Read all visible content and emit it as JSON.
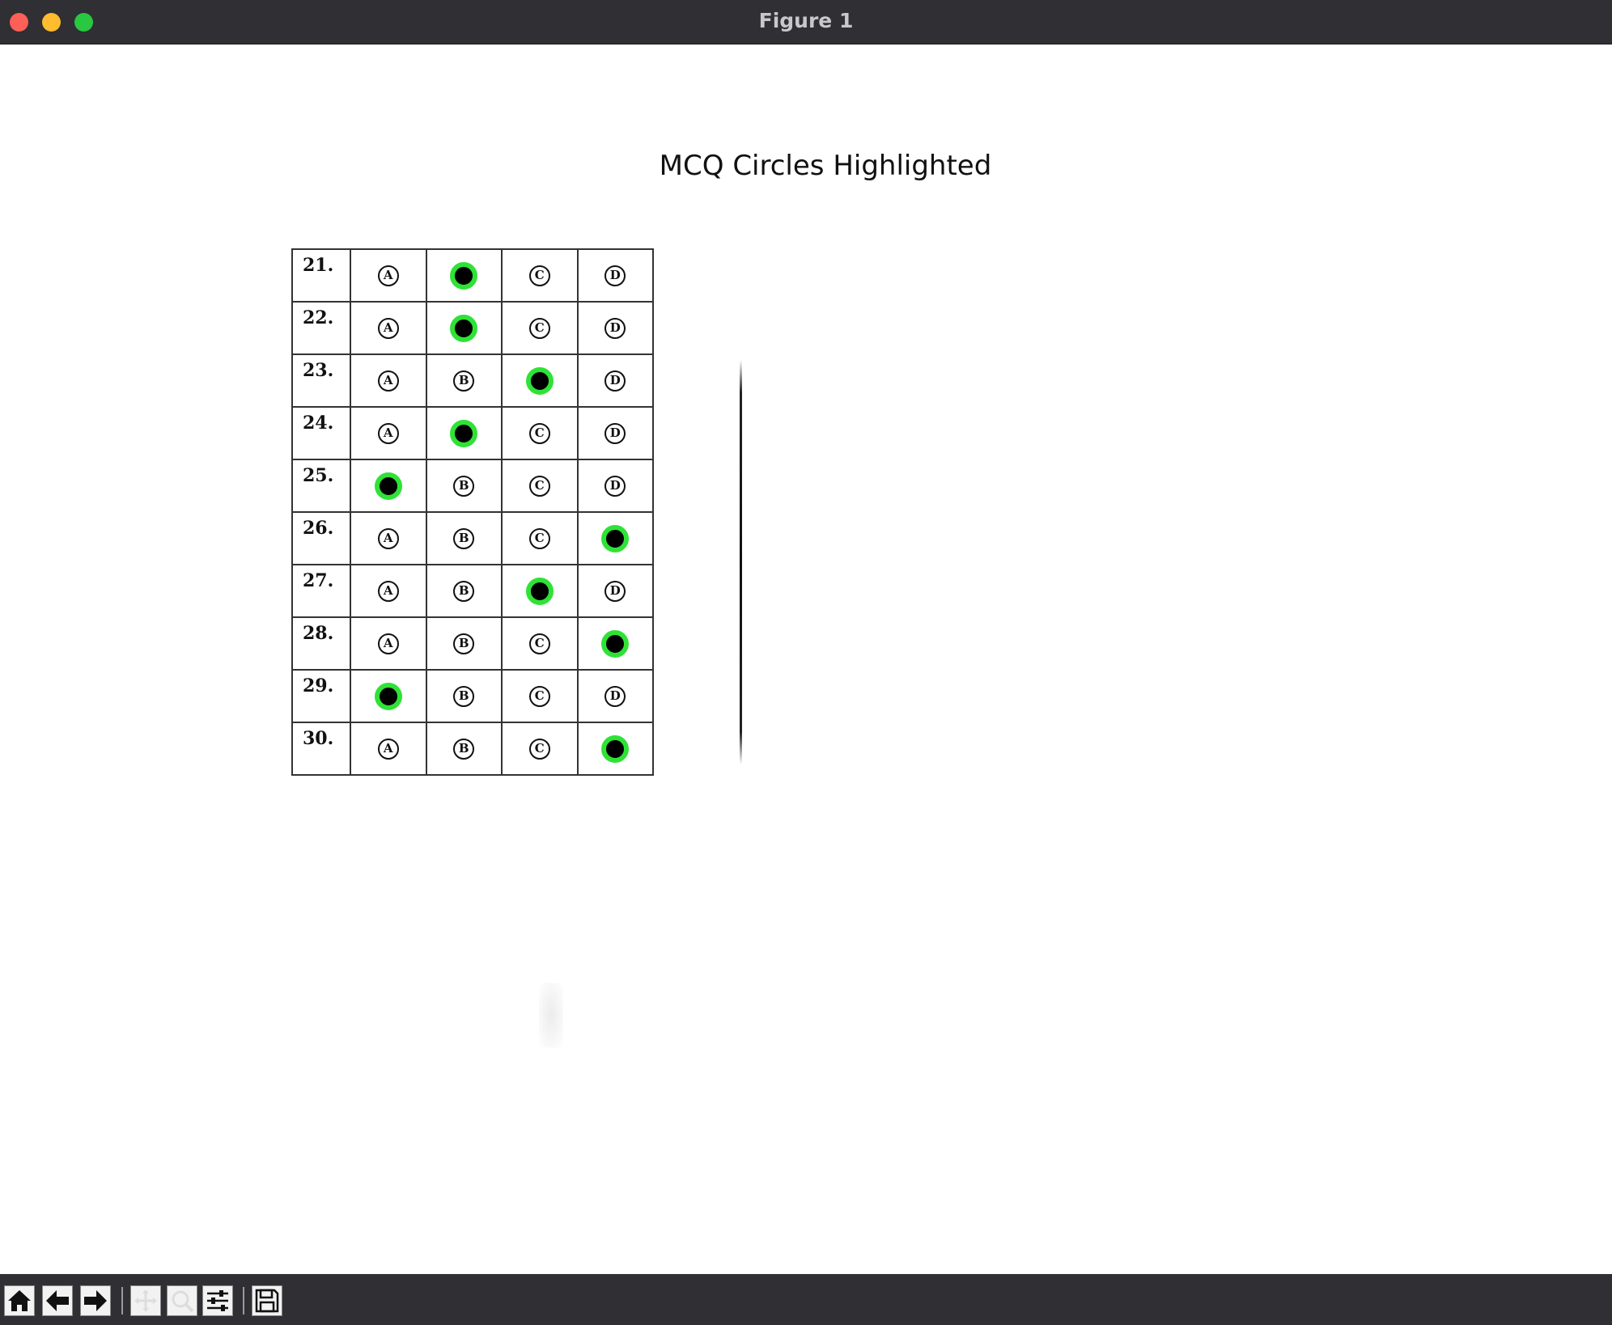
{
  "window": {
    "title": "Figure 1"
  },
  "plot": {
    "title": "MCQ Circles Highlighted"
  },
  "answer_sheet": {
    "rows": [
      {
        "number": "21.",
        "options": [
          "A",
          "B",
          "C",
          "D"
        ],
        "marked": 1
      },
      {
        "number": "22.",
        "options": [
          "A",
          "B",
          "C",
          "D"
        ],
        "marked": 1
      },
      {
        "number": "23.",
        "options": [
          "A",
          "B",
          "C",
          "D"
        ],
        "marked": 2
      },
      {
        "number": "24.",
        "options": [
          "A",
          "B",
          "C",
          "D"
        ],
        "marked": 1
      },
      {
        "number": "25.",
        "options": [
          "A",
          "B",
          "C",
          "D"
        ],
        "marked": 0
      },
      {
        "number": "26.",
        "options": [
          "A",
          "B",
          "C",
          "D"
        ],
        "marked": 3
      },
      {
        "number": "27.",
        "options": [
          "A",
          "B",
          "C",
          "D"
        ],
        "marked": 2
      },
      {
        "number": "28.",
        "options": [
          "A",
          "B",
          "C",
          "D"
        ],
        "marked": 3
      },
      {
        "number": "29.",
        "options": [
          "A",
          "B",
          "C",
          "D"
        ],
        "marked": 0
      },
      {
        "number": "30.",
        "options": [
          "A",
          "B",
          "C",
          "D"
        ],
        "marked": 3
      }
    ],
    "highlight_color": "#2fe236",
    "fill_color": "#000000"
  },
  "toolbar": {
    "buttons": [
      {
        "name": "home-button",
        "icon": "home-icon"
      },
      {
        "name": "back-button",
        "icon": "arrow-left-icon"
      },
      {
        "name": "forward-button",
        "icon": "arrow-right-icon"
      },
      {
        "name": "pan-button",
        "icon": "pan-icon"
      },
      {
        "name": "zoom-button",
        "icon": "zoom-icon"
      },
      {
        "name": "configure-subplots-button",
        "icon": "sliders-icon"
      },
      {
        "name": "save-button",
        "icon": "save-icon"
      }
    ]
  },
  "colors": {
    "titlebar": "#2f2f34",
    "toolbar": "#2f2f34",
    "close": "#fe5f57",
    "minimize": "#febc2e",
    "maximize": "#28c840"
  }
}
